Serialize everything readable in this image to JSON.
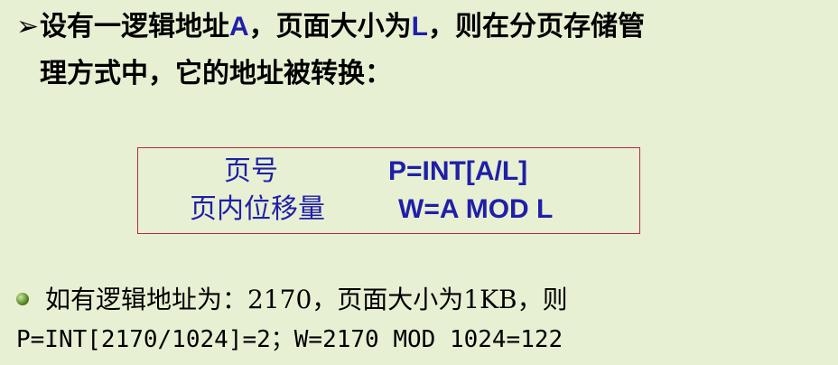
{
  "intro": {
    "arrow": "➢",
    "line1_part1": "设有一逻辑地址",
    "var_a": "A",
    "line1_part2": "，页面大小为",
    "var_l": "L",
    "line1_part3": "，则在分页存储管",
    "line2": "理方式中，它的地址被转换："
  },
  "formula": {
    "page_no_label": "页号",
    "page_no_expr": "P=INT[A/L]",
    "offset_label": "页内位移量",
    "offset_expr": "W=A MOD L"
  },
  "example": {
    "line1": "如有逻辑地址为：2170，页面大小为1KB，则",
    "line2": "P=INT[2170/1024]=2；W=2170 MOD 1024=122"
  },
  "colors": {
    "background": "#e8f0d3",
    "accent_blue": "#1f1fa8",
    "box_border": "#c0263a"
  }
}
